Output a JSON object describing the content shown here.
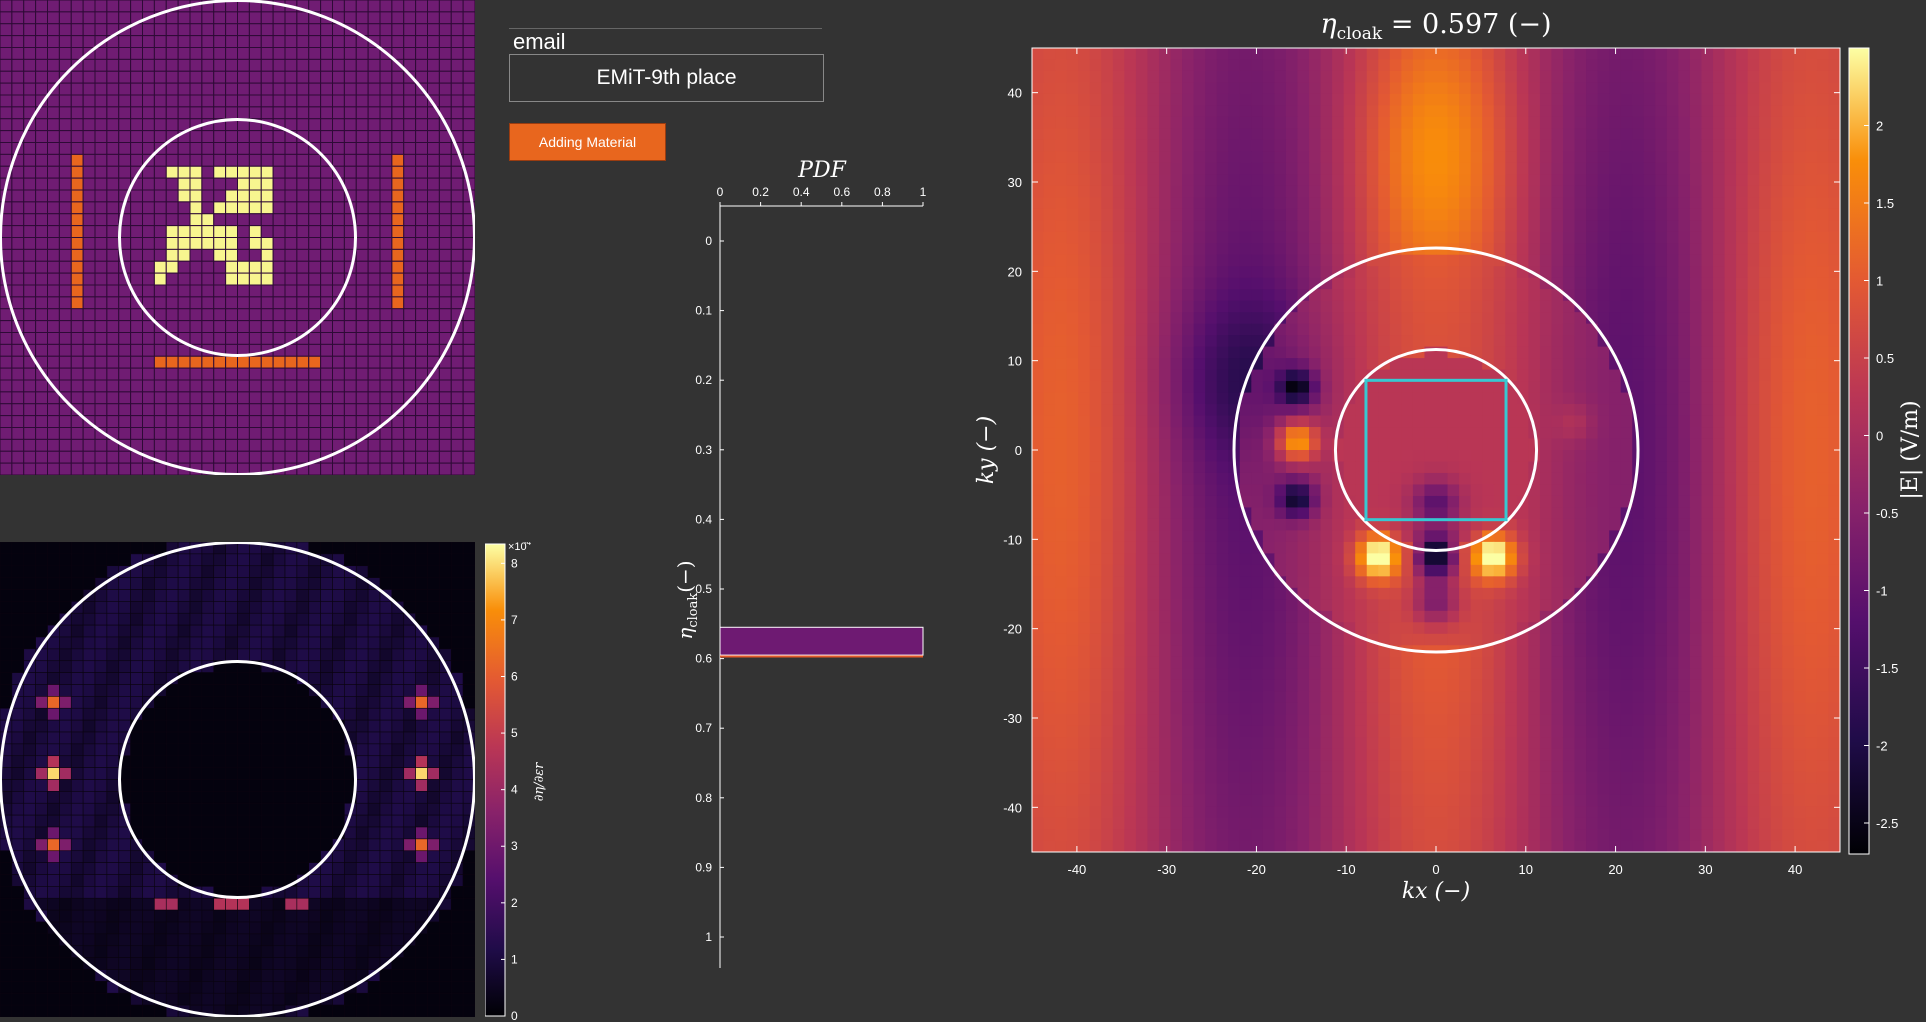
{
  "email_label": "email",
  "name_value": "EMiT-9th place",
  "add_button_label": "Adding Material",
  "colors": {
    "background": "#333333",
    "design_background": "#701c73",
    "design_grid_line": "#2e0a36",
    "material_yellow": "#f8f58f",
    "material_orange": "#e8661e",
    "button_orange": "#e8661e",
    "circle": "#ffffff",
    "cloak_box": "#37c8d2",
    "pdf_bar": "#6e1a72",
    "pdf_bar_line": "#e45a2a"
  },
  "sensitivity": {
    "colorbar_ticks": [
      "0",
      "1",
      "2",
      "3",
      "4",
      "5",
      "6",
      "7",
      "8"
    ],
    "colorbar_exponent": "×10",
    "colorbar_exponent_power": "-4",
    "colorbar_label": "∂η/∂εr"
  },
  "pdf_chart": {
    "title": "PDF",
    "x_ticks": [
      "0",
      "0.2",
      "0.4",
      "0.6",
      "0.8",
      "1"
    ],
    "y_ticks": [
      "0",
      "0.1",
      "0.2",
      "0.3",
      "0.4",
      "0.5",
      "0.6",
      "0.7",
      "0.8",
      "0.9",
      "1"
    ],
    "ylabel_main": "η",
    "ylabel_sub": "cloak",
    "ylabel_tail": "(−)",
    "bar": {
      "y_from": 0.555,
      "y_to": 0.595,
      "x_from": 0,
      "x_to": 1,
      "marker": 0.597
    }
  },
  "field_chart": {
    "title_main": "η",
    "title_sub": "cloak",
    "title_tail": " = 0.597 (−)",
    "x_ticks": [
      "-40",
      "-30",
      "-20",
      "-10",
      "0",
      "10",
      "20",
      "30",
      "40"
    ],
    "y_ticks": [
      "40",
      "30",
      "20",
      "10",
      "0",
      "-10",
      "-20",
      "-30",
      "-40"
    ],
    "xlabel": "kx (−)",
    "ylabel": "ky (−)",
    "colorbar_ticks": [
      "2",
      "1.5",
      "1",
      "0.5",
      "0",
      "-0.5",
      "-1",
      "-1.5",
      "-2",
      "-2.5"
    ],
    "colorbar_label": "|E| (V/m)",
    "xlim": [
      -45,
      45
    ],
    "ylim": [
      -45,
      45
    ],
    "clim": [
      -2.7,
      2.5
    ],
    "outer_radius": 22.5,
    "inner_radius": 11.2,
    "cloak_box": [
      -7.8,
      7.8,
      -7.8,
      7.8
    ]
  }
}
